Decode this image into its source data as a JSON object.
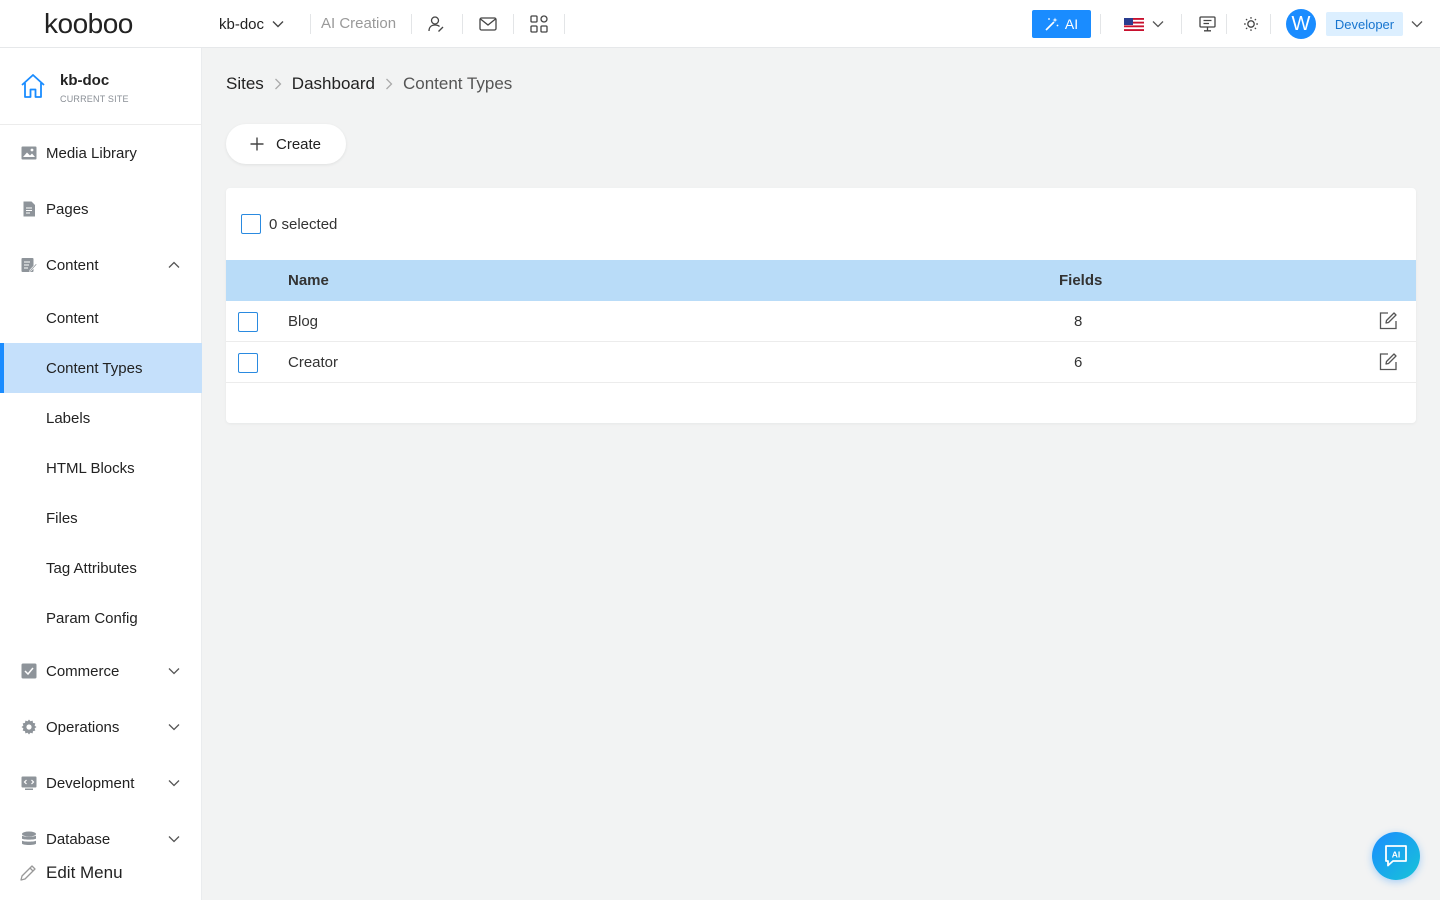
{
  "brand": {
    "logo_text": "kooboo"
  },
  "topbar": {
    "site_name": "kb-doc",
    "ai_creation": "AI Creation",
    "ai_button": "AI",
    "avatar_initial": "W",
    "role": "Developer"
  },
  "sidebar": {
    "current_site": {
      "name": "kb-doc",
      "caption": "CURRENT SITE"
    },
    "items": [
      {
        "label": "Media Library",
        "icon": "image-icon",
        "level": 1
      },
      {
        "label": "Pages",
        "icon": "page-icon",
        "level": 1
      },
      {
        "label": "Content",
        "icon": "content-icon",
        "level": 1,
        "expanded": true
      },
      {
        "label": "Content",
        "level": 2
      },
      {
        "label": "Content Types",
        "level": 2,
        "active": true
      },
      {
        "label": "Labels",
        "level": 2
      },
      {
        "label": "HTML Blocks",
        "level": 2
      },
      {
        "label": "Files",
        "level": 2
      },
      {
        "label": "Tag Attributes",
        "level": 2
      },
      {
        "label": "Param Config",
        "level": 2
      },
      {
        "label": "Commerce",
        "icon": "commerce-icon",
        "level": 1,
        "expanded": false
      },
      {
        "label": "Operations",
        "icon": "gear-icon",
        "level": 1,
        "expanded": false
      },
      {
        "label": "Development",
        "icon": "code-icon",
        "level": 1,
        "expanded": false
      },
      {
        "label": "Database",
        "icon": "database-icon",
        "level": 1,
        "expanded": false
      }
    ],
    "edit_menu": "Edit Menu"
  },
  "breadcrumb": [
    "Sites",
    "Dashboard",
    "Content Types"
  ],
  "toolbar": {
    "create_label": "Create"
  },
  "table": {
    "selected_text": "0 selected",
    "columns": [
      "Name",
      "Fields"
    ],
    "rows": [
      {
        "name": "Blog",
        "fields": "8"
      },
      {
        "name": "Creator",
        "fields": "6"
      }
    ]
  },
  "colors": {
    "accent": "#1a8cff",
    "active_bg": "#c5e0fb",
    "table_header": "#b9dcf8",
    "role_bg": "#dcefff"
  }
}
